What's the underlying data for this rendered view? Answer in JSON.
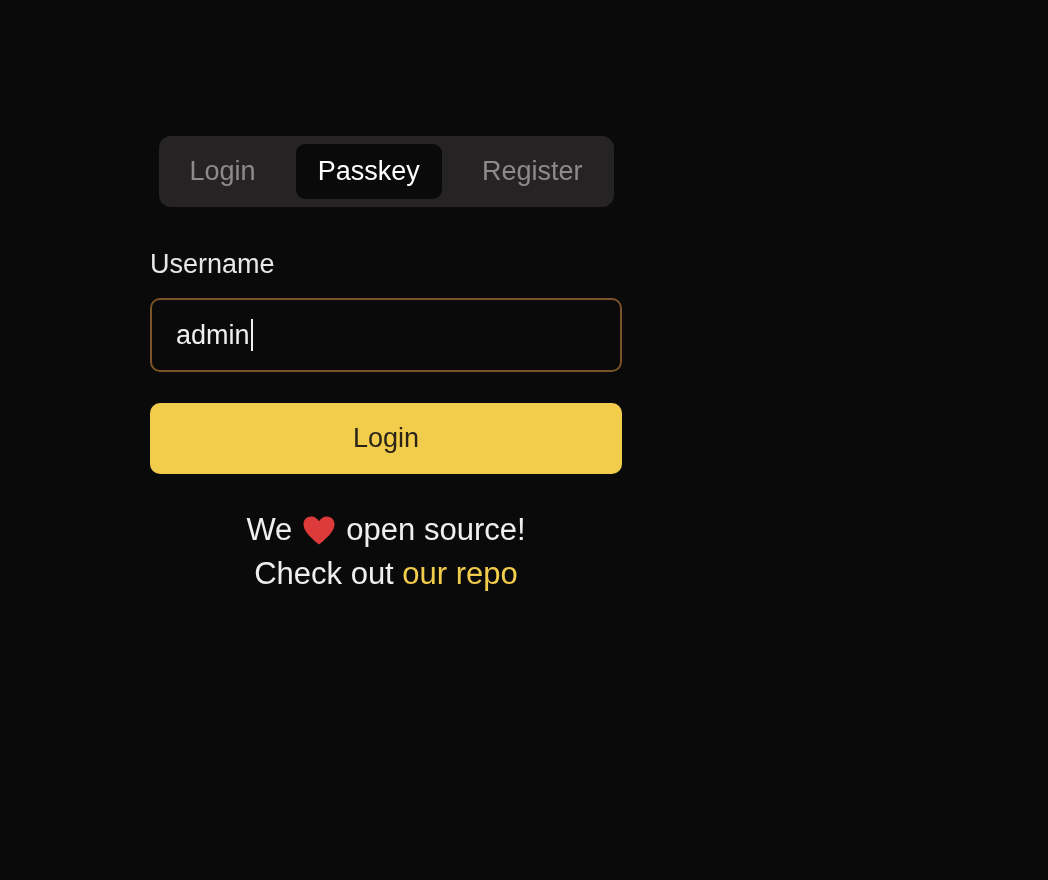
{
  "tabs": [
    {
      "label": "Login",
      "selected": false
    },
    {
      "label": "Passkey",
      "selected": true
    },
    {
      "label": "Register",
      "selected": false
    }
  ],
  "username": {
    "label": "Username",
    "value": "admin"
  },
  "button": "Login",
  "footer": {
    "before": "We",
    "after": "open source!",
    "line2": "Check out",
    "link": "our repo"
  }
}
